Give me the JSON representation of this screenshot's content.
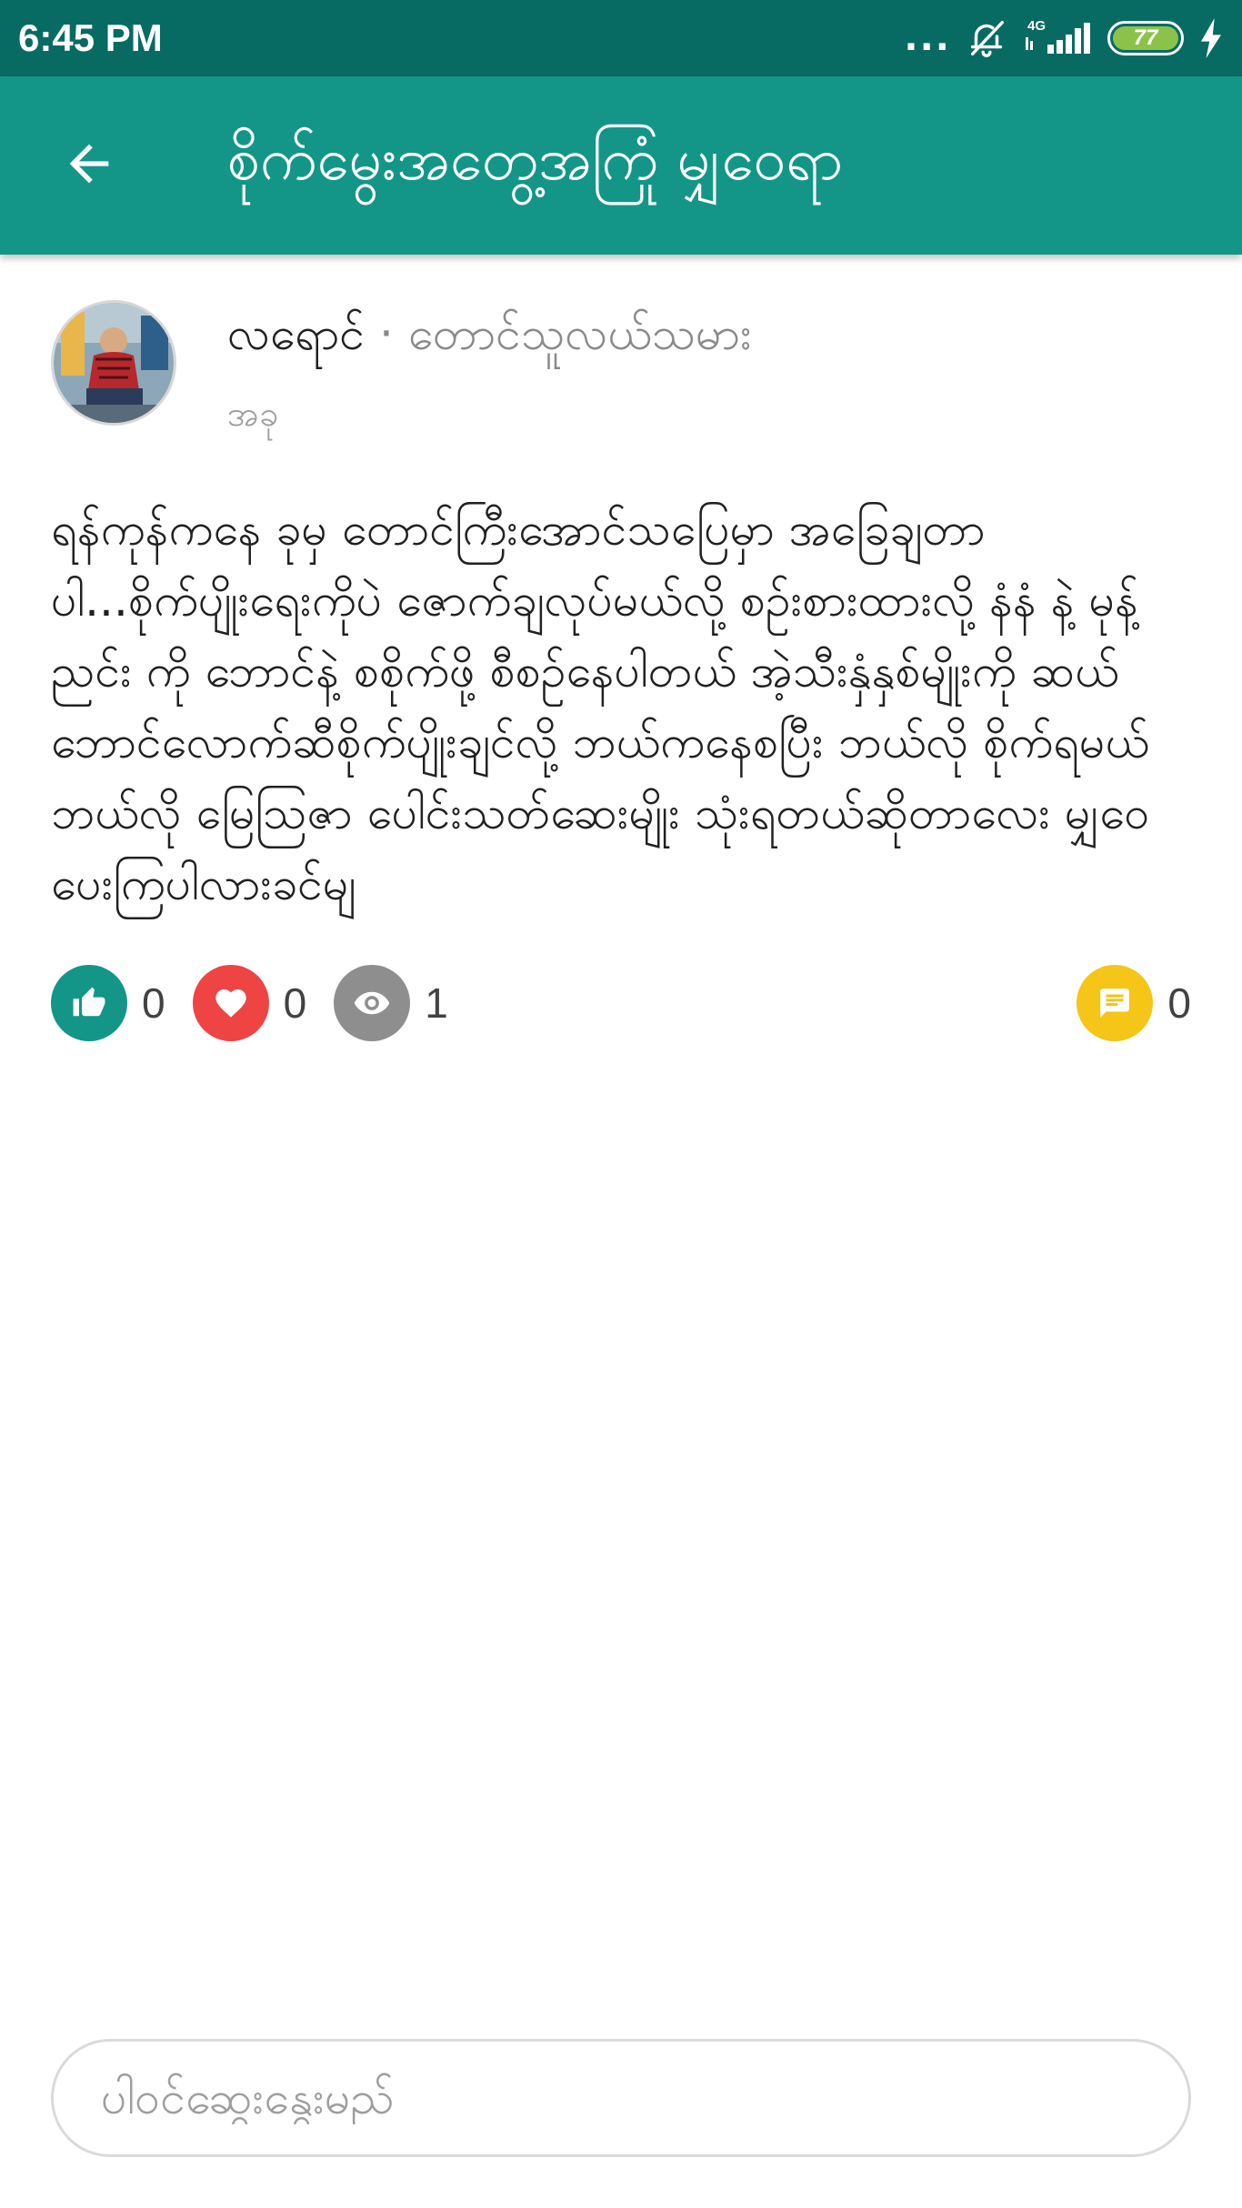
{
  "status_bar": {
    "time": "6:45 PM",
    "dots": "...",
    "network": "4G",
    "battery": "77"
  },
  "app_bar": {
    "title": "စိုက်မွေးအတွေ့အကြုံ မျှဝေရာ"
  },
  "post": {
    "author": {
      "name": "လရောင်",
      "separator": "·",
      "role": "တောင်သူလယ်သမား",
      "meta": "အခု"
    },
    "body": "ရန်ကုန်ကနေ ခုမှ တောင်ကြီးအောင်သပြေမှာ အခြေချတာပါ...စိုက်ပျိုးရေးကိုပဲ ဇောက်ချလုပ်မယ်လို့  စဥ်းစားထားလို့ နံနံ နဲ့ မုန့်ညင်း ကို ဘောင်နဲ့ စစိုက်ဖို့ စီစဥ်နေပါတယ် အဲ့သီးနှံနှစ်မျိုးကို ဆယ်ဘောင်လောက်ဆီစိုက်ပျိုးချင်လို့ ဘယ်ကနေစပြီး ဘယ်လို စိုက်ရမယ် ဘယ်လို မြေဩဇာ ပေါင်းသတ်ဆေးမျိုး သုံးရတယ်ဆိုတာလေး မျှဝေပေးကြပါလားခင်မျ",
    "reactions": {
      "likes": "0",
      "hearts": "0",
      "views": "1",
      "comments": "0"
    }
  },
  "comment": {
    "placeholder": "ပါဝင်ဆွေးနွေးမည်"
  },
  "colors": {
    "status_bar": "#086b63",
    "app_bar": "#139688",
    "like": "#139688",
    "heart": "#ef4444",
    "view": "#8e8e8e",
    "comment": "#f5c518"
  },
  "icons": {
    "back": "arrow-left-icon",
    "like": "thumbs-up-icon",
    "heart": "heart-icon",
    "view": "eye-icon",
    "comment": "chat-bubble-icon"
  }
}
